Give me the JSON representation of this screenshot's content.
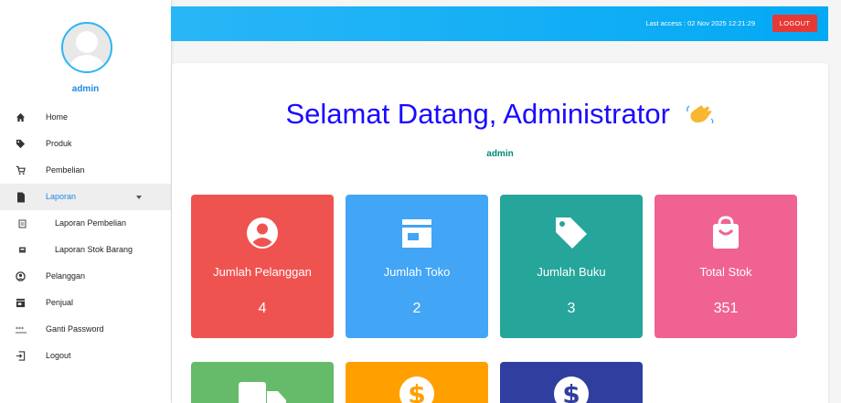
{
  "sidebar": {
    "username": "admin",
    "items": [
      {
        "label": "Home",
        "icon": "home-icon"
      },
      {
        "label": "Produk",
        "icon": "tag-icon"
      },
      {
        "label": "Pembelian",
        "icon": "cart-icon"
      },
      {
        "label": "Laporan",
        "icon": "file-icon"
      },
      {
        "label": "Laporan Pembelian",
        "icon": "receipt-icon"
      },
      {
        "label": "Laporan Stok Barang",
        "icon": "inbox-icon"
      },
      {
        "label": "Pelanggan",
        "icon": "user-circle-icon"
      },
      {
        "label": "Penjual",
        "icon": "store-icon"
      },
      {
        "label": "Ganti Password",
        "icon": "password-icon"
      },
      {
        "label": "Logout",
        "icon": "logout-icon"
      }
    ]
  },
  "header": {
    "last_access": "Last access : 02 Nov 2025 12:21:29",
    "logout_label": "LOGOUT"
  },
  "main": {
    "welcome": "Selamat Datang, Administrator",
    "role": "admin",
    "cards": [
      {
        "label": "Jumlah Pelanggan",
        "value": "4",
        "color": "#ef5350",
        "icon": "user-circle-icon"
      },
      {
        "label": "Jumlah Toko",
        "value": "2",
        "color": "#42a5f5",
        "icon": "store-icon"
      },
      {
        "label": "Jumlah Buku",
        "value": "3",
        "color": "#26a69a",
        "icon": "tag-icon"
      },
      {
        "label": "Total Stok",
        "value": "351",
        "color": "#f06292",
        "icon": "shopping-bag-icon"
      }
    ],
    "cards_row2": [
      {
        "color": "#66bb6a",
        "icon": "truck-icon"
      },
      {
        "color": "#ffa000",
        "icon": "dollar-icon"
      },
      {
        "color": "#303f9f",
        "icon": "dollar-icon"
      }
    ]
  },
  "colors": {
    "accent": "#29b6f6",
    "welcome_text": "#1a0aff",
    "role_text": "#00897b",
    "logout": "#e53935"
  }
}
